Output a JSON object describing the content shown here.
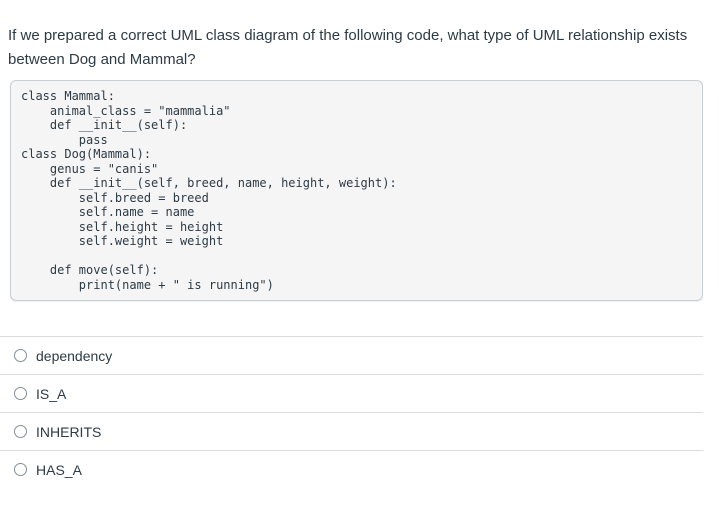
{
  "question": {
    "text": "If we prepared a correct UML class diagram of the following code, what type of UML relationship exists between Dog and Mammal?",
    "code": "class Mammal:\n    animal_class = \"mammalia\"\n    def __init__(self):\n        pass\nclass Dog(Mammal):\n    genus = \"canis\"\n    def __init__(self, breed, name, height, weight):\n        self.breed = breed\n        self.name = name\n        self.height = height\n        self.weight = weight\n\n    def move(self):\n        print(name + \" is running\")"
  },
  "options": [
    {
      "label": "dependency",
      "selected": false
    },
    {
      "label": "IS_A",
      "selected": false
    },
    {
      "label": "INHERITS",
      "selected": false
    },
    {
      "label": "HAS_A",
      "selected": false
    }
  ],
  "colors": {
    "text": "#2d3b45",
    "code_background": "#f5f5f6",
    "code_border": "#c7cdd1",
    "divider": "#dcdcdc",
    "radio_border": "#848e97"
  }
}
